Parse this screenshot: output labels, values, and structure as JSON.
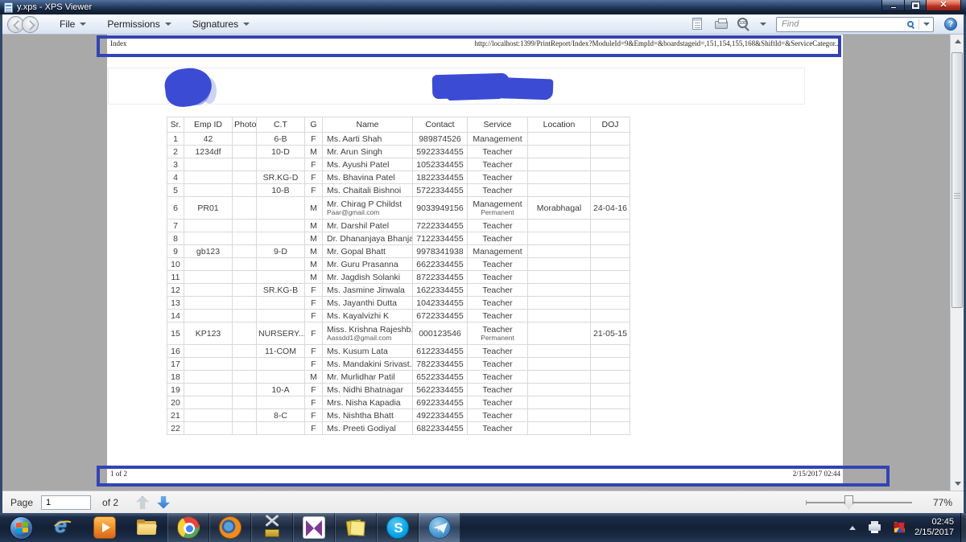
{
  "window": {
    "title": "y.xps - XPS Viewer"
  },
  "menu": {
    "items": [
      {
        "label": "File"
      },
      {
        "label": "Permissions"
      },
      {
        "label": "Signatures"
      }
    ]
  },
  "toolbar": {
    "find_placeholder": "Find"
  },
  "document": {
    "header_left": "Index",
    "header_url": "http://localhost:1399/PrintReport/Index?ModuleId=9&EmpId=&boardstageid=,151,154,155,168&ShiftId=&ServiceCategor...",
    "footer_left": "1 of 2",
    "footer_right": "2/15/2017 02:44"
  },
  "table": {
    "headers": [
      "Sr.",
      "Emp ID",
      "Photo",
      "C.T",
      "G",
      "Name",
      "Contact",
      "Service",
      "Location",
      "DOJ"
    ],
    "rows": [
      {
        "sr": "1",
        "emp": "42",
        "photo": "",
        "ct": "6-B",
        "g": "F",
        "name": "Ms. Aarti Shah",
        "email": "",
        "contact": "989874526",
        "service": "Management",
        "service_sub": "",
        "location": "",
        "doj": ""
      },
      {
        "sr": "2",
        "emp": "1234df",
        "photo": "",
        "ct": "10-D",
        "g": "M",
        "name": "Mr. Arun Singh",
        "email": "",
        "contact": "5922334455",
        "service": "Teacher",
        "service_sub": "",
        "location": "",
        "doj": ""
      },
      {
        "sr": "3",
        "emp": "",
        "photo": "",
        "ct": "",
        "g": "F",
        "name": "Ms. Ayushi Patel",
        "email": "",
        "contact": "1052334455",
        "service": "Teacher",
        "service_sub": "",
        "location": "",
        "doj": ""
      },
      {
        "sr": "4",
        "emp": "",
        "photo": "",
        "ct": "SR.KG-D",
        "g": "F",
        "name": "Ms. Bhavina Patel",
        "email": "",
        "contact": "1822334455",
        "service": "Teacher",
        "service_sub": "",
        "location": "",
        "doj": ""
      },
      {
        "sr": "5",
        "emp": "",
        "photo": "",
        "ct": "10-B",
        "g": "F",
        "name": "Ms. Chaitali Bishnoi",
        "email": "",
        "contact": "5722334455",
        "service": "Teacher",
        "service_sub": "",
        "location": "",
        "doj": ""
      },
      {
        "sr": "6",
        "emp": "PR01",
        "photo": "",
        "ct": "",
        "g": "M",
        "name": "Mr. Chirag P Childst",
        "email": "Paar@gmail.com",
        "contact": "9033949156",
        "service": "Management",
        "service_sub": "Permanent",
        "location": "Morabhagal",
        "doj": "24-04-16"
      },
      {
        "sr": "7",
        "emp": "",
        "photo": "",
        "ct": "",
        "g": "M",
        "name": "Mr. Darshil Patel",
        "email": "",
        "contact": "7222334455",
        "service": "Teacher",
        "service_sub": "",
        "location": "",
        "doj": ""
      },
      {
        "sr": "8",
        "emp": "",
        "photo": "",
        "ct": "",
        "g": "M",
        "name": "Dr. Dhananjaya Bhanja",
        "email": "",
        "contact": "7122334455",
        "service": "Teacher",
        "service_sub": "",
        "location": "",
        "doj": ""
      },
      {
        "sr": "9",
        "emp": "gb123",
        "photo": "",
        "ct": "9-D",
        "g": "M",
        "name": "Mr. Gopal Bhatt",
        "email": "",
        "contact": "9978341938",
        "service": "Management",
        "service_sub": "",
        "location": "",
        "doj": ""
      },
      {
        "sr": "10",
        "emp": "",
        "photo": "",
        "ct": "",
        "g": "M",
        "name": "Mr. Guru Prasanna",
        "email": "",
        "contact": "6622334455",
        "service": "Teacher",
        "service_sub": "",
        "location": "",
        "doj": ""
      },
      {
        "sr": "11",
        "emp": "",
        "photo": "",
        "ct": "",
        "g": "M",
        "name": "Mr. Jagdish Solanki",
        "email": "",
        "contact": "8722334455",
        "service": "Teacher",
        "service_sub": "",
        "location": "",
        "doj": ""
      },
      {
        "sr": "12",
        "emp": "",
        "photo": "",
        "ct": "SR.KG-B",
        "g": "F",
        "name": "Ms. Jasmine Jinwala",
        "email": "",
        "contact": "1622334455",
        "service": "Teacher",
        "service_sub": "",
        "location": "",
        "doj": ""
      },
      {
        "sr": "13",
        "emp": "",
        "photo": "",
        "ct": "",
        "g": "F",
        "name": "Ms. Jayanthi Dutta",
        "email": "",
        "contact": "1042334455",
        "service": "Teacher",
        "service_sub": "",
        "location": "",
        "doj": ""
      },
      {
        "sr": "14",
        "emp": "",
        "photo": "",
        "ct": "",
        "g": "F",
        "name": "Ms. Kayalvizhi K",
        "email": "",
        "contact": "6722334455",
        "service": "Teacher",
        "service_sub": "",
        "location": "",
        "doj": ""
      },
      {
        "sr": "15",
        "emp": "KP123",
        "photo": "",
        "ct": "NURSERY...",
        "g": "F",
        "name": "Miss. Krishna Rajeshb...",
        "email": "Aassdd1@gmail.com",
        "contact": "000123546",
        "service": "Teacher",
        "service_sub": "Permanent",
        "location": "",
        "doj": "21-05-15"
      },
      {
        "sr": "16",
        "emp": "",
        "photo": "",
        "ct": "11-COM",
        "g": "F",
        "name": "Ms. Kusum Lata",
        "email": "",
        "contact": "6122334455",
        "service": "Teacher",
        "service_sub": "",
        "location": "",
        "doj": ""
      },
      {
        "sr": "17",
        "emp": "",
        "photo": "",
        "ct": "",
        "g": "F",
        "name": "Ms. Mandakini Srivast...",
        "email": "",
        "contact": "7822334455",
        "service": "Teacher",
        "service_sub": "",
        "location": "",
        "doj": ""
      },
      {
        "sr": "18",
        "emp": "",
        "photo": "",
        "ct": "",
        "g": "M",
        "name": "Mr. Murlidhar Patil",
        "email": "",
        "contact": "6522334455",
        "service": "Teacher",
        "service_sub": "",
        "location": "",
        "doj": ""
      },
      {
        "sr": "19",
        "emp": "",
        "photo": "",
        "ct": "10-A",
        "g": "F",
        "name": "Ms. Nidhi Bhatnagar",
        "email": "",
        "contact": "5622334455",
        "service": "Teacher",
        "service_sub": "",
        "location": "",
        "doj": ""
      },
      {
        "sr": "20",
        "emp": "",
        "photo": "",
        "ct": "",
        "g": "F",
        "name": "Mrs. Nisha Kapadia",
        "email": "",
        "contact": "6922334455",
        "service": "Teacher",
        "service_sub": "",
        "location": "",
        "doj": ""
      },
      {
        "sr": "21",
        "emp": "",
        "photo": "",
        "ct": "8-C",
        "g": "F",
        "name": "Ms. Nishtha Bhatt",
        "email": "",
        "contact": "4922334455",
        "service": "Teacher",
        "service_sub": "",
        "location": "",
        "doj": ""
      },
      {
        "sr": "22",
        "emp": "",
        "photo": "",
        "ct": "",
        "g": "F",
        "name": "Ms. Preeti Godiyal",
        "email": "",
        "contact": "6822334455",
        "service": "Teacher",
        "service_sub": "",
        "location": "",
        "doj": ""
      }
    ]
  },
  "pagenav": {
    "label": "Page",
    "value": "1",
    "of": "of 2",
    "zoom": "77%"
  },
  "taskbar": {
    "buttons": [
      {
        "id": "start",
        "name": "start-orb",
        "framed": false,
        "active": false
      },
      {
        "id": "ie",
        "name": "internet-explorer",
        "framed": false,
        "active": false
      },
      {
        "id": "wmp",
        "name": "windows-media-player",
        "framed": false,
        "active": false
      },
      {
        "id": "folder",
        "name": "windows-explorer",
        "framed": false,
        "active": false
      },
      {
        "id": "chrome",
        "name": "google-chrome",
        "framed": true,
        "active": false
      },
      {
        "id": "firefox",
        "name": "firefox",
        "framed": true,
        "active": false
      },
      {
        "id": "tools",
        "name": "admin-tools",
        "framed": true,
        "active": false
      },
      {
        "id": "vs",
        "name": "visual-studio",
        "framed": true,
        "active": false
      },
      {
        "id": "notes",
        "name": "sticky-notes",
        "framed": true,
        "active": false
      },
      {
        "id": "skype",
        "name": "skype",
        "framed": true,
        "active": false
      },
      {
        "id": "telegram",
        "name": "telegram",
        "framed": true,
        "active": true
      }
    ]
  },
  "tray": {
    "time": "02:45",
    "date": "2/15/2017"
  },
  "colors": {
    "annotation_blue": "#3443b4",
    "redaction_blue": "#3c4bd4",
    "taskbar_active": "#8cb4e6"
  }
}
